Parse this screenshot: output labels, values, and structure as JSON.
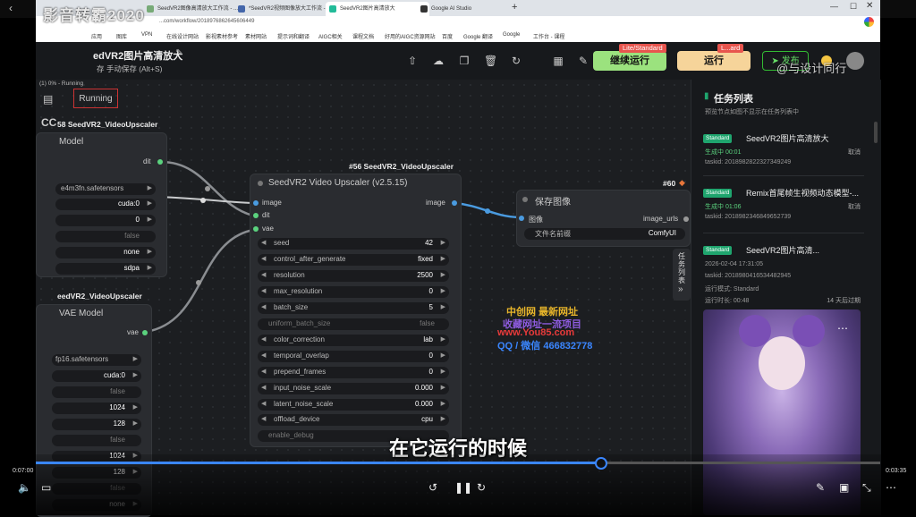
{
  "video": {
    "overlay_title": "影音转霸2020",
    "current_time": "0:07:00",
    "total_time": "0:03:35",
    "subtitle": "在它运行的时候",
    "progress_fraction": 0.668
  },
  "browser": {
    "tabs": [
      {
        "label": "SeedVR2图像高清放大工作流 - ..."
      },
      {
        "label": "*SeedVR2视频图像放大工作流 - ..."
      },
      {
        "label": "SeedVR2图片高清放大"
      },
      {
        "label": "Google AI Studio"
      }
    ],
    "url": "...com/workflow/2018976862645606449",
    "bookmarks": [
      "应用",
      "图库",
      "VPN",
      "在线设计网站",
      "影视素材参考",
      "素材网站",
      "提示词和翻译",
      "AIGC相关",
      "课程文档",
      "好用的AIGC资源网站",
      "百度",
      "Google 翻译",
      "Google",
      "工作台 - 课程"
    ]
  },
  "header": {
    "title": "edVR2图片高清放大",
    "save_mode": "存   手动保存 (Alt+S)",
    "continue_label": "继续运行",
    "run_label": "运行",
    "tag_lite": "Lite/Standard",
    "tag_lite2": "L...ard",
    "publish_label": "发布",
    "watermark": "@与设计同行"
  },
  "canvas": {
    "status": "(1) 0% - Running",
    "running_badge": "Running",
    "node_left1": {
      "title": "58 SeedVR2_VideoUpscaler",
      "head": "Model",
      "port_out": "dit",
      "widgets": [
        "e4m3fn.safetensors",
        "cuda:0",
        "0",
        "false",
        "none",
        "sdpa"
      ]
    },
    "node_left2": {
      "title": "eedVR2_VideoUpscaler",
      "head": "VAE Model",
      "port_out": "vae",
      "widgets": [
        "fp16.safetensors",
        "cuda:0",
        "false",
        "1024",
        "128",
        "false",
        "1024",
        "128",
        "false",
        "none"
      ]
    },
    "node_main": {
      "id_title": "#56 SeedVR2_VideoUpscaler",
      "head": "SeedVR2 Video Upscaler (v2.5.15)",
      "in_ports": [
        "image",
        "dit",
        "vae"
      ],
      "out_port": "image",
      "widgets": [
        {
          "label": "seed",
          "value": "42"
        },
        {
          "label": "control_after_generate",
          "value": "fixed"
        },
        {
          "label": "resolution",
          "value": "2500"
        },
        {
          "label": "max_resolution",
          "value": "0"
        },
        {
          "label": "batch_size",
          "value": "5"
        },
        {
          "label": "uniform_batch_size",
          "value": "false"
        },
        {
          "label": "color_correction",
          "value": "lab"
        },
        {
          "label": "temporal_overlap",
          "value": "0"
        },
        {
          "label": "prepend_frames",
          "value": "0"
        },
        {
          "label": "input_noise_scale",
          "value": "0.000"
        },
        {
          "label": "latent_noise_scale",
          "value": "0.000"
        },
        {
          "label": "offload_device",
          "value": "cpu"
        },
        {
          "label": "enable_debug",
          "value": ""
        }
      ]
    },
    "node_save": {
      "id_title": "#60",
      "head": "保存图像",
      "in_port": "图像",
      "out_port": "image_urls",
      "widget_label": "文件名前缀",
      "widget_value": "ComfyUI"
    },
    "promo": [
      "中创网 最新网址",
      "收藏网址一流项目",
      "www.You85.com",
      "QQ / 微信 466832778"
    ]
  },
  "panel": {
    "title": "任务列表",
    "desc": "预览节点如图不显示在任务列表中",
    "collapse_label": "任务列表",
    "tasks": [
      {
        "badge": "Standard",
        "name": "SeedVR2图片高清放大",
        "status": "生成中 00:01",
        "cancel": "取消",
        "taskid": "taskid: 2018982822327349249"
      },
      {
        "badge": "Standard",
        "name": "Remix首尾帧生视频动态模型-...",
        "status": "生成中 01:06",
        "cancel": "取消",
        "taskid": "taskid: 2018982346849652739"
      },
      {
        "badge": "Standard",
        "name": "SeedVR2图片高清...",
        "date": "2026-02-04 17:31:05",
        "taskid": "taskid: 2018980416534482945",
        "mode": "运行模式: Standard",
        "duration": "运行时长: 00:48",
        "expire": "14 天后过期"
      }
    ]
  },
  "colors": {
    "accent_green": "#9be27e",
    "run_orange": "#f6d49a",
    "badge_green": "#1fa56e",
    "progress_blue": "#3a86ff"
  }
}
